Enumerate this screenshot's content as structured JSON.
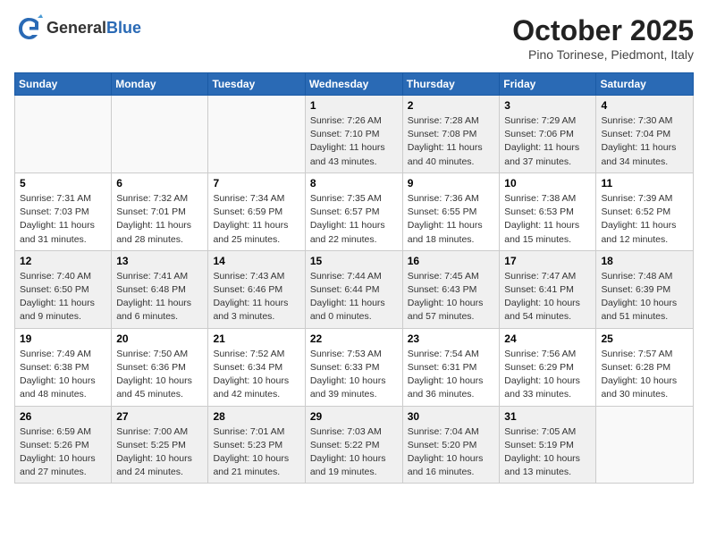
{
  "header": {
    "logo_general": "General",
    "logo_blue": "Blue",
    "month_title": "October 2025",
    "location": "Pino Torinese, Piedmont, Italy"
  },
  "weekdays": [
    "Sunday",
    "Monday",
    "Tuesday",
    "Wednesday",
    "Thursday",
    "Friday",
    "Saturday"
  ],
  "weeks": [
    [
      {
        "day": "",
        "info": ""
      },
      {
        "day": "",
        "info": ""
      },
      {
        "day": "",
        "info": ""
      },
      {
        "day": "1",
        "info": "Sunrise: 7:26 AM\nSunset: 7:10 PM\nDaylight: 11 hours\nand 43 minutes."
      },
      {
        "day": "2",
        "info": "Sunrise: 7:28 AM\nSunset: 7:08 PM\nDaylight: 11 hours\nand 40 minutes."
      },
      {
        "day": "3",
        "info": "Sunrise: 7:29 AM\nSunset: 7:06 PM\nDaylight: 11 hours\nand 37 minutes."
      },
      {
        "day": "4",
        "info": "Sunrise: 7:30 AM\nSunset: 7:04 PM\nDaylight: 11 hours\nand 34 minutes."
      }
    ],
    [
      {
        "day": "5",
        "info": "Sunrise: 7:31 AM\nSunset: 7:03 PM\nDaylight: 11 hours\nand 31 minutes."
      },
      {
        "day": "6",
        "info": "Sunrise: 7:32 AM\nSunset: 7:01 PM\nDaylight: 11 hours\nand 28 minutes."
      },
      {
        "day": "7",
        "info": "Sunrise: 7:34 AM\nSunset: 6:59 PM\nDaylight: 11 hours\nand 25 minutes."
      },
      {
        "day": "8",
        "info": "Sunrise: 7:35 AM\nSunset: 6:57 PM\nDaylight: 11 hours\nand 22 minutes."
      },
      {
        "day": "9",
        "info": "Sunrise: 7:36 AM\nSunset: 6:55 PM\nDaylight: 11 hours\nand 18 minutes."
      },
      {
        "day": "10",
        "info": "Sunrise: 7:38 AM\nSunset: 6:53 PM\nDaylight: 11 hours\nand 15 minutes."
      },
      {
        "day": "11",
        "info": "Sunrise: 7:39 AM\nSunset: 6:52 PM\nDaylight: 11 hours\nand 12 minutes."
      }
    ],
    [
      {
        "day": "12",
        "info": "Sunrise: 7:40 AM\nSunset: 6:50 PM\nDaylight: 11 hours\nand 9 minutes."
      },
      {
        "day": "13",
        "info": "Sunrise: 7:41 AM\nSunset: 6:48 PM\nDaylight: 11 hours\nand 6 minutes."
      },
      {
        "day": "14",
        "info": "Sunrise: 7:43 AM\nSunset: 6:46 PM\nDaylight: 11 hours\nand 3 minutes."
      },
      {
        "day": "15",
        "info": "Sunrise: 7:44 AM\nSunset: 6:44 PM\nDaylight: 11 hours\nand 0 minutes."
      },
      {
        "day": "16",
        "info": "Sunrise: 7:45 AM\nSunset: 6:43 PM\nDaylight: 10 hours\nand 57 minutes."
      },
      {
        "day": "17",
        "info": "Sunrise: 7:47 AM\nSunset: 6:41 PM\nDaylight: 10 hours\nand 54 minutes."
      },
      {
        "day": "18",
        "info": "Sunrise: 7:48 AM\nSunset: 6:39 PM\nDaylight: 10 hours\nand 51 minutes."
      }
    ],
    [
      {
        "day": "19",
        "info": "Sunrise: 7:49 AM\nSunset: 6:38 PM\nDaylight: 10 hours\nand 48 minutes."
      },
      {
        "day": "20",
        "info": "Sunrise: 7:50 AM\nSunset: 6:36 PM\nDaylight: 10 hours\nand 45 minutes."
      },
      {
        "day": "21",
        "info": "Sunrise: 7:52 AM\nSunset: 6:34 PM\nDaylight: 10 hours\nand 42 minutes."
      },
      {
        "day": "22",
        "info": "Sunrise: 7:53 AM\nSunset: 6:33 PM\nDaylight: 10 hours\nand 39 minutes."
      },
      {
        "day": "23",
        "info": "Sunrise: 7:54 AM\nSunset: 6:31 PM\nDaylight: 10 hours\nand 36 minutes."
      },
      {
        "day": "24",
        "info": "Sunrise: 7:56 AM\nSunset: 6:29 PM\nDaylight: 10 hours\nand 33 minutes."
      },
      {
        "day": "25",
        "info": "Sunrise: 7:57 AM\nSunset: 6:28 PM\nDaylight: 10 hours\nand 30 minutes."
      }
    ],
    [
      {
        "day": "26",
        "info": "Sunrise: 6:59 AM\nSunset: 5:26 PM\nDaylight: 10 hours\nand 27 minutes."
      },
      {
        "day": "27",
        "info": "Sunrise: 7:00 AM\nSunset: 5:25 PM\nDaylight: 10 hours\nand 24 minutes."
      },
      {
        "day": "28",
        "info": "Sunrise: 7:01 AM\nSunset: 5:23 PM\nDaylight: 10 hours\nand 21 minutes."
      },
      {
        "day": "29",
        "info": "Sunrise: 7:03 AM\nSunset: 5:22 PM\nDaylight: 10 hours\nand 19 minutes."
      },
      {
        "day": "30",
        "info": "Sunrise: 7:04 AM\nSunset: 5:20 PM\nDaylight: 10 hours\nand 16 minutes."
      },
      {
        "day": "31",
        "info": "Sunrise: 7:05 AM\nSunset: 5:19 PM\nDaylight: 10 hours\nand 13 minutes."
      },
      {
        "day": "",
        "info": ""
      }
    ]
  ]
}
